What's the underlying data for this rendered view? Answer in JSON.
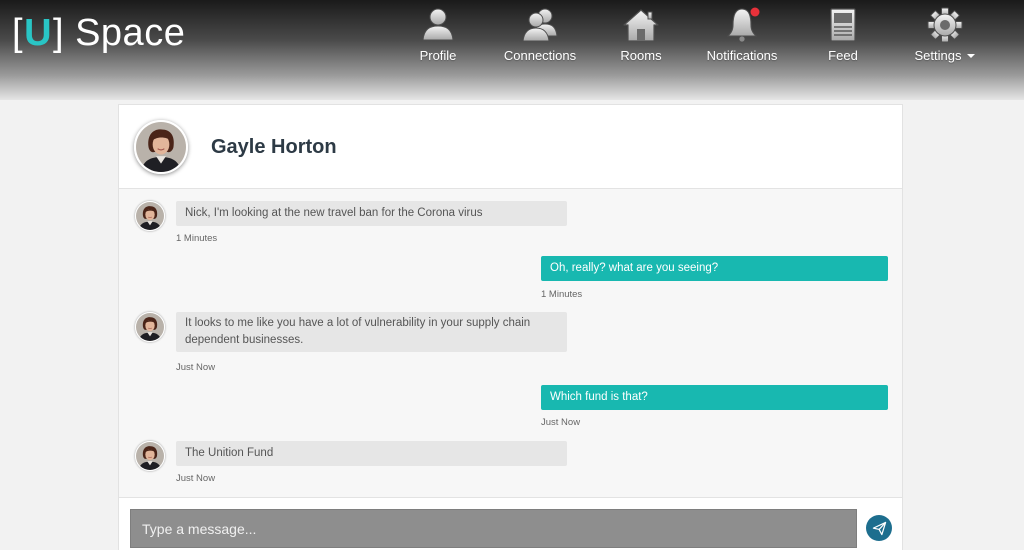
{
  "brand": {
    "bracket_left": "[",
    "bracket_letter": "U",
    "bracket_right": "]",
    "name": "Space",
    "accent_color": "#29c5c5"
  },
  "nav": {
    "items": [
      {
        "label": "Profile",
        "icon": "person-icon"
      },
      {
        "label": "Connections",
        "icon": "people-icon"
      },
      {
        "label": "Rooms",
        "icon": "house-icon"
      },
      {
        "label": "Notifications",
        "icon": "bell-icon",
        "has_unread_dot": true
      },
      {
        "label": "Feed",
        "icon": "document-icon"
      },
      {
        "label": "Settings",
        "icon": "gear-icon",
        "has_dropdown": true
      }
    ]
  },
  "chat": {
    "contact_name": "Gayle Horton",
    "outgoing_color": "#18b8b0",
    "messages": [
      {
        "direction": "incoming",
        "text": "Nick, I'm looking at the new travel ban for the Corona virus",
        "time": "1 Minutes"
      },
      {
        "direction": "outgoing",
        "text": "Oh, really? what are you seeing?",
        "time": "1 Minutes"
      },
      {
        "direction": "incoming",
        "text": "It looks to me like you have a lot of vulnerability in your supply chain dependent businesses.",
        "time": "Just Now"
      },
      {
        "direction": "outgoing",
        "text": "Which fund is that?",
        "time": "Just Now"
      },
      {
        "direction": "incoming",
        "text": "The Unition Fund",
        "time": "Just Now"
      }
    ],
    "composer": {
      "placeholder": "Type a message...",
      "value": "",
      "send_icon": "paper-plane-icon"
    }
  }
}
